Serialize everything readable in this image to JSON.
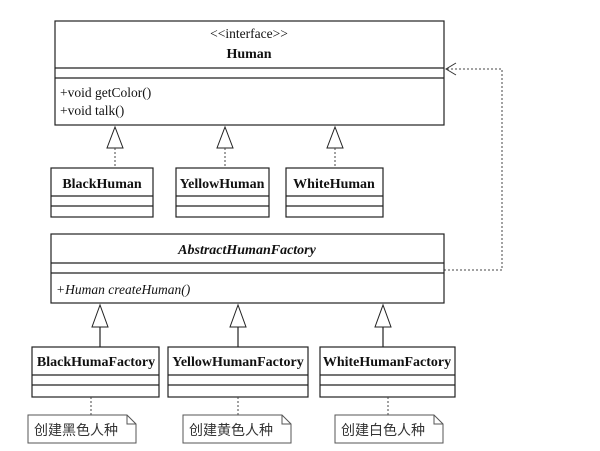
{
  "human": {
    "stereotype": "<<interface>>",
    "name": "Human",
    "methods": [
      "+void getColor()",
      "+void talk()"
    ]
  },
  "humans": [
    "BlackHuman",
    "YellowHuman",
    "WhiteHuman"
  ],
  "factory": {
    "name": "AbstractHumanFactory",
    "methods": [
      "+Human createHuman()"
    ]
  },
  "factories": [
    "BlackHumaFactory",
    "YellowHumanFactory",
    "WhiteHumanFactory"
  ],
  "notes": [
    "创建黑色人种",
    "创建黄色人种",
    "创建白色人种"
  ]
}
